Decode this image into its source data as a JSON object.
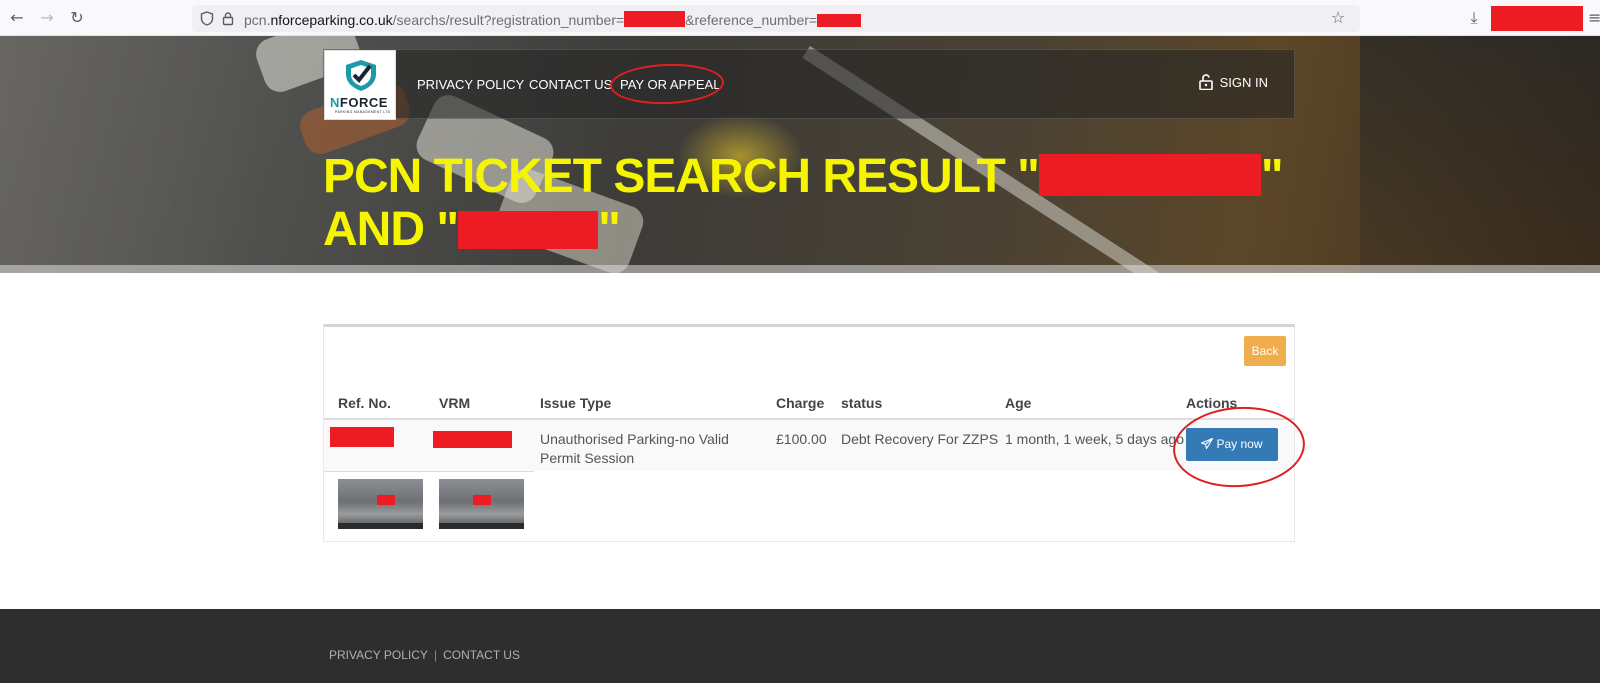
{
  "browser": {
    "url_prefix": "pcn.",
    "url_host": "nforceparking.co.uk",
    "url_path": "/searchs/result?registration_number=",
    "url_mid": "&reference_number=",
    "back_glyph": "←",
    "forward_glyph": "→",
    "reload_glyph": "↻",
    "star_glyph": "☆",
    "download_glyph": "⤓",
    "menu_glyph": "≡"
  },
  "header": {
    "logo_word_n": "N",
    "logo_word_rest": "FORCE",
    "logo_sub": "PARKING MANAGEMENT LTD",
    "nav": [
      {
        "label": "PRIVACY POLICY"
      },
      {
        "label": "CONTACT US"
      },
      {
        "label": "PAY OR APPEAL"
      }
    ],
    "signin_label": "SIGN IN"
  },
  "hero": {
    "title_part1": "PCN TICKET SEARCH RESULT \"",
    "title_part2": "\"",
    "title_part3": "AND \"",
    "title_part4": "\""
  },
  "panel": {
    "back_label": "Back",
    "columns": [
      "Ref. No.",
      "VRM",
      "Issue Type",
      "Charge",
      "status",
      "Age",
      "Actions"
    ],
    "row": {
      "issue_type": "Unauthorised Parking-no Valid Permit Session",
      "charge": "£100.00",
      "status": "Debt Recovery For ZZPS",
      "age": "1 month, 1 week, 5 days ago",
      "action_label": "Pay now"
    }
  },
  "footer": {
    "links": [
      "PRIVACY POLICY",
      "CONTACT US"
    ],
    "separator": "|"
  },
  "colors": {
    "title_yellow": "#f5f500",
    "pay_button_blue": "#337ab7",
    "back_button_orange": "#f0ad4e",
    "redaction_red": "#ed1c24",
    "annotation_red": "#e02020",
    "footer_bg": "#2e2e2e"
  },
  "icons": {
    "lock": "lock-open-icon",
    "send": "paper-plane-icon",
    "shield": "shield-icon"
  }
}
